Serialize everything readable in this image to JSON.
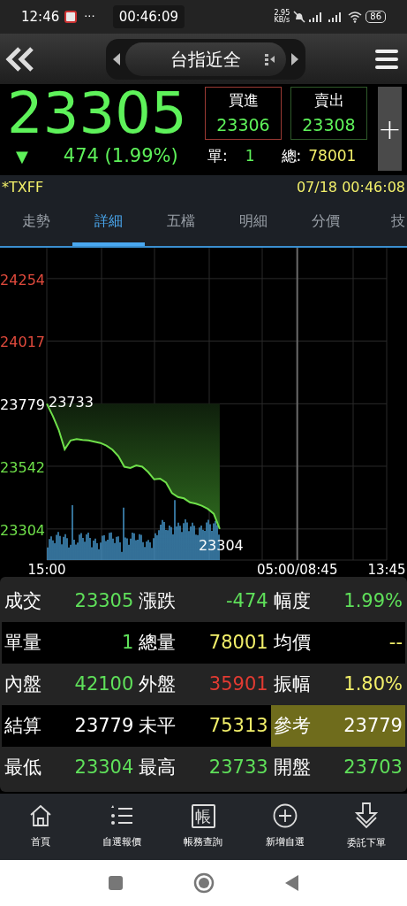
{
  "status_bar": {
    "time": "12:46",
    "dots": "···",
    "timer": "00:46:09",
    "speed": "2.95",
    "speed_unit": "KB/s",
    "battery": "86"
  },
  "nav": {
    "title": "台指近全"
  },
  "quote": {
    "price": "23305",
    "direction": "▼",
    "change": "474 (1.99%)",
    "bid": {
      "label": "買進",
      "value": "23306"
    },
    "ask": {
      "label": "賣出",
      "value": "23308"
    },
    "single_label": "單:",
    "single_value": "1",
    "total_label": "總:",
    "total_value": "78001",
    "add": "+"
  },
  "info_bar": {
    "symbol": "*TXFF",
    "datetime": "07/18 00:46:08"
  },
  "tabs": [
    {
      "label": "走勢",
      "selected": false
    },
    {
      "label": "詳細",
      "selected": true
    },
    {
      "label": "五檔",
      "selected": false
    },
    {
      "label": "明細",
      "selected": false
    },
    {
      "label": "分價",
      "selected": false
    },
    {
      "label": "技",
      "selected": false
    }
  ],
  "chart": {
    "chart_data": {
      "type": "line",
      "categories": [
        "15:00",
        null,
        null,
        null,
        null,
        null,
        null,
        null,
        null,
        null,
        null,
        null,
        null,
        null,
        null,
        null,
        null,
        null,
        null,
        null,
        null,
        null,
        null,
        null,
        null,
        null,
        null,
        null,
        null,
        null,
        null,
        null,
        null,
        null,
        null,
        null,
        null,
        null,
        null,
        null,
        null,
        null,
        "05:00/08:45",
        null,
        null,
        null,
        null,
        null,
        null,
        null,
        null,
        null,
        null,
        null,
        null,
        null,
        null,
        "13:45"
      ],
      "values": [
        23779,
        23733,
        23680,
        23606,
        23640,
        23645,
        23642,
        23640,
        23635,
        23630,
        23620,
        23605,
        23580,
        23540,
        23535,
        23545,
        23540,
        23520,
        23492,
        23495,
        23480,
        23440,
        23425,
        23420,
        23405,
        23400,
        23392,
        23380,
        23362,
        23304,
        null,
        null,
        null,
        null,
        null,
        null,
        null,
        null,
        null,
        null,
        null,
        null,
        null,
        null,
        null,
        null,
        null,
        null,
        null,
        null,
        null,
        null,
        null,
        null,
        null,
        null,
        null,
        null
      ],
      "ylim": [
        23186,
        24371
      ],
      "grid": true,
      "yticks": [
        24254,
        24017,
        23779,
        23542,
        23304
      ],
      "annotations": [
        "23733",
        "23304"
      ]
    }
  },
  "table": [
    [
      {
        "label": "成交",
        "value": "23305",
        "color": "#5fe05a",
        "highlighted": false
      },
      {
        "label": "漲跌",
        "value": "-474",
        "color": "#5fe05a",
        "highlighted": false
      },
      {
        "label": "幅度",
        "value": "1.99%",
        "color": "#5fe05a",
        "highlighted": false
      }
    ],
    [
      {
        "label": "單量",
        "value": "1",
        "color": "#5fe05a",
        "highlighted": false
      },
      {
        "label": "總量",
        "value": "78001",
        "color": "#f2ef6a",
        "highlighted": false
      },
      {
        "label": "均價",
        "value": "--",
        "color": "#f2ef6a",
        "highlighted": false
      }
    ],
    [
      {
        "label": "內盤",
        "value": "42100",
        "color": "#5fe05a",
        "highlighted": false
      },
      {
        "label": "外盤",
        "value": "35901",
        "color": "#e23b32",
        "highlighted": false
      },
      {
        "label": "振幅",
        "value": "1.80%",
        "color": "#f2ef6a",
        "highlighted": false
      }
    ],
    [
      {
        "label": "結算",
        "value": "23779",
        "color": "#ffffff",
        "highlighted": false
      },
      {
        "label": "未平",
        "value": "75313",
        "color": "#f2ef6a",
        "highlighted": false
      },
      {
        "label": "參考",
        "value": "23779",
        "color": "#ffffff",
        "highlighted": true
      }
    ],
    [
      {
        "label": "最低",
        "value": "23304",
        "color": "#5fe05a",
        "highlighted": false
      },
      {
        "label": "最高",
        "value": "23733",
        "color": "#5fe05a",
        "highlighted": false
      },
      {
        "label": "開盤",
        "value": "23703",
        "color": "#5fe05a",
        "highlighted": false
      }
    ]
  ],
  "bottom_nav": [
    {
      "kind": "home",
      "label": "首頁"
    },
    {
      "kind": "list",
      "label": "自選報價"
    },
    {
      "kind": "glyph",
      "glyph": "帳",
      "label": "帳務查詢"
    },
    {
      "kind": "plus",
      "label": "新增自選"
    },
    {
      "kind": "download",
      "label": "委託下單"
    }
  ]
}
